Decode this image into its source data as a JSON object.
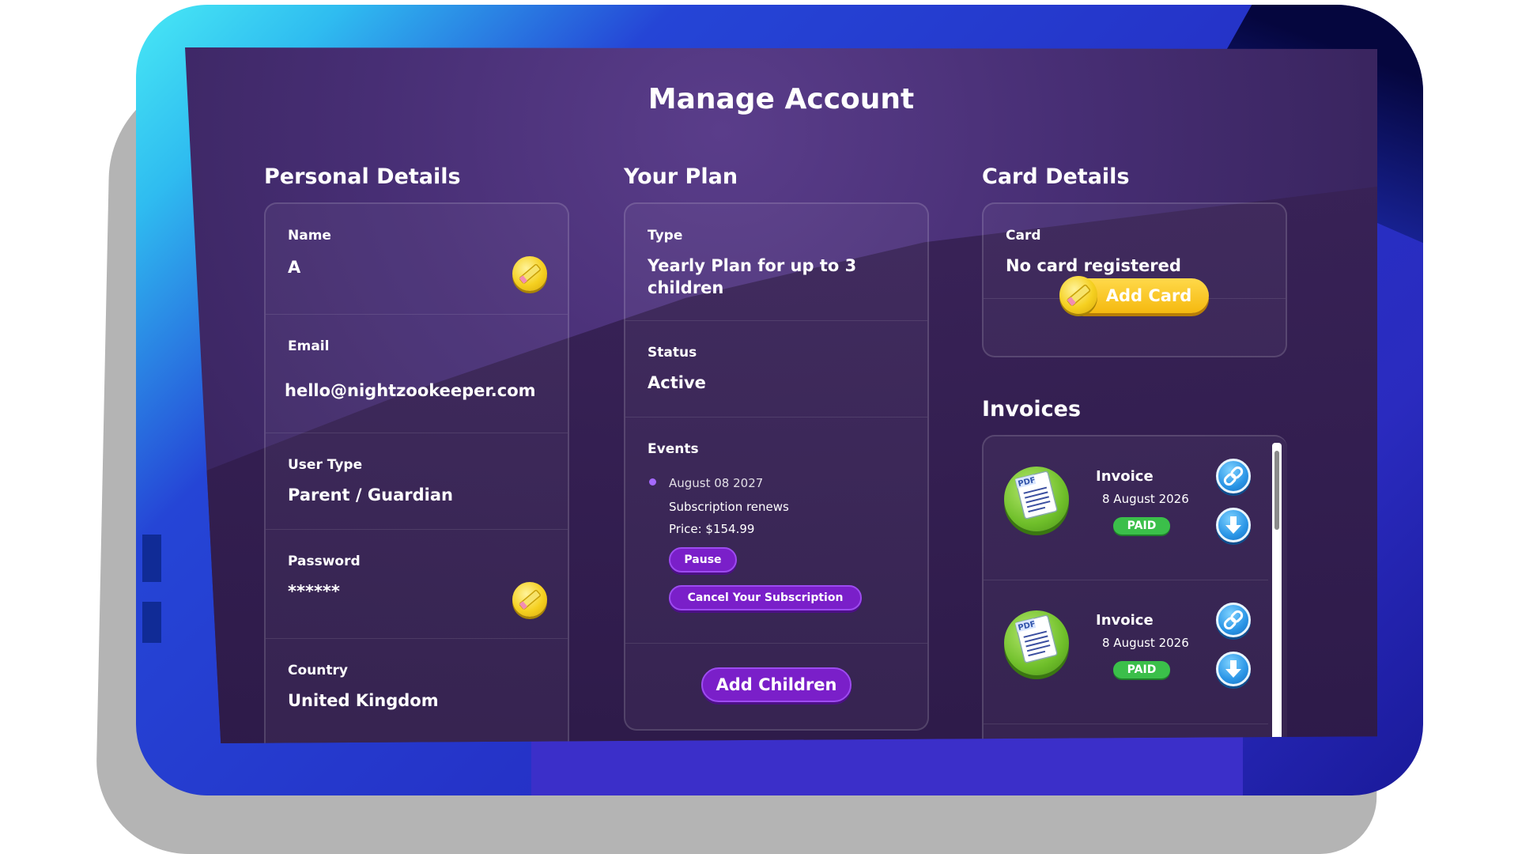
{
  "page": {
    "title": "Manage Account"
  },
  "personal": {
    "heading": "Personal Details",
    "name_label": "Name",
    "name_value": "A",
    "email_label": "Email",
    "email_value": "hello@nightzookeeper.com",
    "user_type_label": "User Type",
    "user_type_value": "Parent / Guardian",
    "password_label": "Password",
    "password_value": "******",
    "country_label": "Country",
    "country_value": "United Kingdom"
  },
  "plan": {
    "heading": "Your Plan",
    "type_label": "Type",
    "type_value": "Yearly Plan for up to 3 children",
    "status_label": "Status",
    "status_value": "Active",
    "events_label": "Events",
    "event_date": "August 08 2027",
    "event_desc": "Subscription renews",
    "event_price": "Price: $154.99",
    "pause_label": "Pause",
    "cancel_label": "Cancel Your Subscription",
    "add_children_label": "Add Children"
  },
  "card": {
    "heading": "Card Details",
    "card_label": "Card",
    "card_value": "No card registered",
    "add_card_label": "Add Card"
  },
  "invoices": {
    "heading": "Invoices",
    "items": [
      {
        "title": "Invoice",
        "date": "8 August 2026",
        "status": "PAID"
      },
      {
        "title": "Invoice",
        "date": "8 August 2026",
        "status": "PAID"
      }
    ]
  },
  "icons": {
    "edit": "pencil-icon",
    "pdf": "pdf-document-icon",
    "link": "link-icon",
    "download": "download-arrow-icon"
  },
  "colors": {
    "primary_purple": "#7a1fc9",
    "accent_yellow": "#f5c518",
    "paid_green": "#3bbf4a",
    "action_blue": "#2a95e6"
  }
}
